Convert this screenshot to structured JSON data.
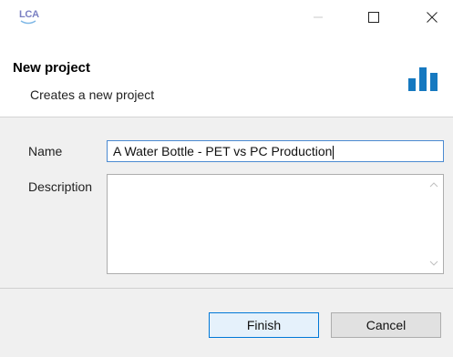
{
  "window": {
    "logo_text": "LCA",
    "controls": {
      "minimize_icon": "minimize-icon",
      "maximize_icon": "maximize-icon",
      "close_icon": "close-icon"
    }
  },
  "header": {
    "title": "New project",
    "subtitle": "Creates a new project",
    "icon": "bar-chart-icon",
    "icon_color": "#1679c0"
  },
  "form": {
    "name_label": "Name",
    "name_value": "A Water Bottle - PET vs PC Production",
    "description_label": "Description",
    "description_value": ""
  },
  "footer": {
    "finish_label": "Finish",
    "cancel_label": "Cancel"
  },
  "colors": {
    "accent": "#0078d7",
    "input_focus_border": "#4b8ad1",
    "logo": "#7a7fc2"
  }
}
